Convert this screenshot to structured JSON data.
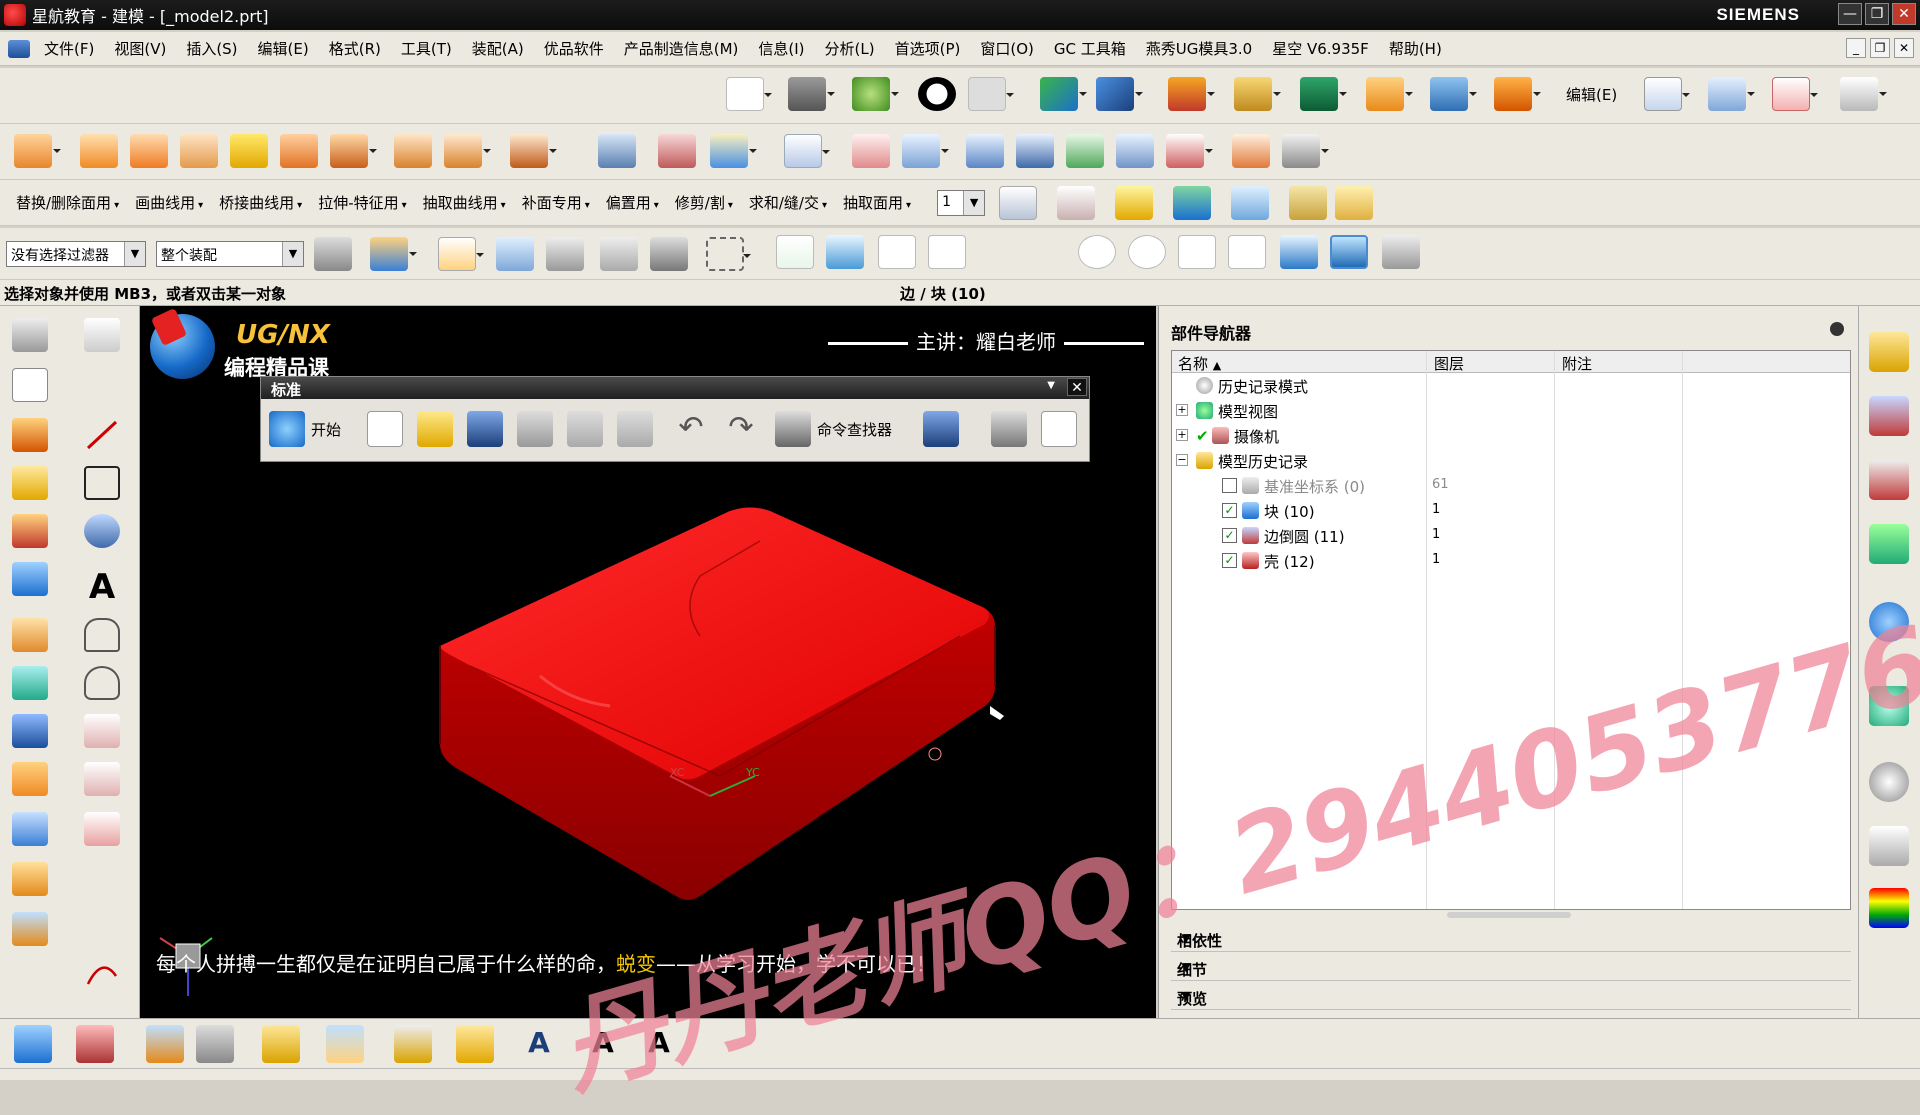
{
  "window": {
    "title": "星航教育 - 建模 - [_model2.prt]",
    "brand": "SIEMENS",
    "buttons": [
      "—",
      "❐",
      "✕"
    ]
  },
  "menu": {
    "items": [
      "文件(F)",
      "视图(V)",
      "插入(S)",
      "编辑(E)",
      "格式(R)",
      "工具(T)",
      "装配(A)",
      "优品软件",
      "产品制造信息(M)",
      "信息(I)",
      "分析(L)",
      "首选项(P)",
      "窗口(O)",
      "GC 工具箱",
      "燕秀UG模具3.0",
      "星空 V6.935F",
      "帮助(H)"
    ]
  },
  "toolbar_row1": {
    "edit_label": "编辑(E)"
  },
  "command_row": {
    "items": [
      "替换/删除面用",
      "画曲线用",
      "桥接曲线用",
      "拉伸-特征用",
      "抽取曲线用",
      "补面专用",
      "偏置用",
      "修剪/割",
      "求和/缝/交",
      "抽取面用"
    ],
    "layer_value": "1"
  },
  "selection": {
    "filter": "没有选择过滤器",
    "scope": "整个装配"
  },
  "status": {
    "prompt": "选择对象并使用 MB3，或者双击某一对象",
    "selected": "边 / 块 (10)"
  },
  "viewport": {
    "course_brand": "UG/NX",
    "course_sub": "编程精品课",
    "lecturer": "主讲：耀白老师",
    "standard_toolbar": {
      "title": "标准",
      "start_label": "开始",
      "finder_label": "命令查找器"
    },
    "subtitle_pre": "每个人拼搏一生都仅是在证明自己属于什么样的命，",
    "subtitle_hl": "蜕变",
    "subtitle_post": "——从学习开始，学不可以已！",
    "axis_labels": [
      "XC",
      "YC"
    ]
  },
  "watermark": "丹丹老师QQ：2944053776",
  "navigator": {
    "title": "部件导航器",
    "columns": [
      "名称",
      "图层",
      "附注"
    ],
    "rows": [
      {
        "name": "历史记录模式",
        "layer": "",
        "indent": 0,
        "expander": "",
        "check": false
      },
      {
        "name": "模型视图",
        "layer": "",
        "indent": 0,
        "expander": "+",
        "check": false
      },
      {
        "name": "摄像机",
        "layer": "",
        "indent": 0,
        "expander": "+",
        "check": false
      },
      {
        "name": "模型历史记录",
        "layer": "",
        "indent": 0,
        "expander": "−",
        "check": false
      },
      {
        "name": "基准坐标系 (0)",
        "layer": "61",
        "indent": 1,
        "expander": "",
        "check": false
      },
      {
        "name": "块 (10)",
        "layer": "1",
        "indent": 1,
        "expander": "",
        "check": true
      },
      {
        "name": "边倒圆 (11)",
        "layer": "1",
        "indent": 1,
        "expander": "",
        "check": true
      },
      {
        "name": "壳 (12)",
        "layer": "1",
        "indent": 1,
        "expander": "",
        "check": true
      }
    ],
    "sections": [
      "相依性",
      "细节",
      "预览"
    ]
  },
  "colors": {
    "model_red": "#ff1a1a",
    "watermark": "#f08296",
    "subtitle_highlight": "#f5c800",
    "brand_gold": "#f7c23a"
  }
}
